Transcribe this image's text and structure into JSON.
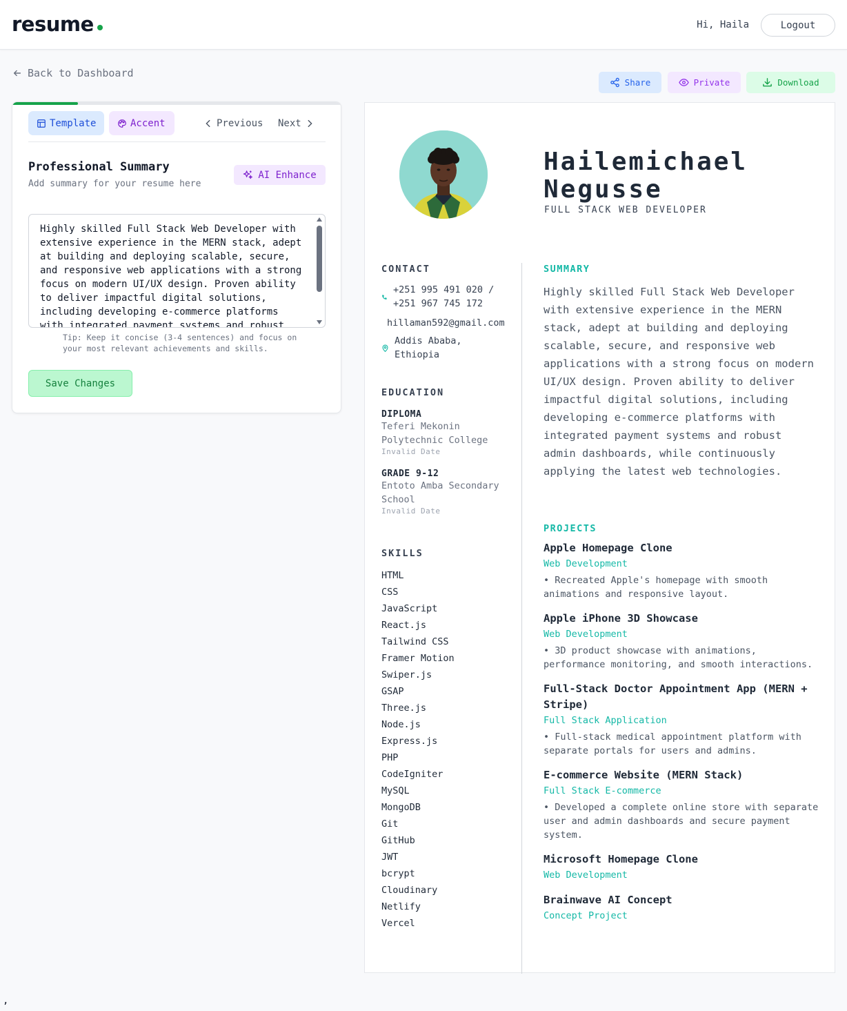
{
  "header": {
    "logo": "resume",
    "greeting": "Hi, Haila",
    "logout_label": "Logout"
  },
  "nav": {
    "back_label": "Back to Dashboard"
  },
  "editor": {
    "progress_fraction": 0.2,
    "template_label": "Template",
    "accent_label": "Accent",
    "previous_label": "Previous",
    "next_label": "Next",
    "section_title": "Professional Summary",
    "section_subtitle": "Add summary for your resume here",
    "ai_label": "AI Enhance",
    "summary_value": "Highly skilled Full Stack Web Developer with\nextensive experience in the MERN stack, adept\nat building and deploying scalable, secure,\nand responsive web applications with a strong\nfocus on modern UI/UX design. Proven ability\nto deliver impactful digital solutions,\nincluding developing e-commerce platforms\nwith integrated payment systems and robust",
    "tip": "Tip: Keep it concise (3-4 sentences) and focus on your most relevant achievements and skills.",
    "save_label": "Save Changes"
  },
  "actions": {
    "share_label": "Share",
    "private_label": "Private",
    "download_label": "Download"
  },
  "resume": {
    "first_name": "Hailemichael",
    "last_name": "Negusse",
    "role": "FULL STACK WEB DEVELOPER",
    "contact_heading": "CONTACT",
    "phone": "+251 995 491 020 /\n+251 967 745 172",
    "email": "hillaman592@gmail.com",
    "location": "Addis Ababa,\nEthiopia",
    "education_heading": "EDUCATION",
    "education": [
      {
        "degree": "DIPLOMA",
        "school": "Teferi Mekonin\nPolytechnic College",
        "date": "Invalid Date"
      },
      {
        "degree": "GRADE 9-12",
        "school": "Entoto Amba Secondary\nSchool",
        "date": "Invalid Date"
      }
    ],
    "skills_heading": "SKILLS",
    "skills": [
      "HTML",
      "CSS",
      "JavaScript",
      "React.js",
      "Tailwind CSS",
      "Framer Motion",
      "Swiper.js",
      "GSAP",
      "Three.js",
      "Node.js",
      "Express.js",
      "PHP",
      "CodeIgniter",
      "MySQL",
      "MongoDB",
      "Git",
      "GitHub",
      "JWT",
      "bcrypt",
      "Cloudinary",
      "Netlify",
      "Vercel"
    ],
    "summary_heading": "SUMMARY",
    "summary": "Highly skilled Full Stack Web Developer with extensive experience in the MERN stack, adept at building and deploying scalable, secure, and responsive web applications with a strong focus on modern UI/UX design. Proven ability to deliver impactful digital solutions, including developing e-commerce platforms with integrated payment systems and robust admin dashboards, while continuously applying the latest web technologies.",
    "projects_heading": "PROJECTS",
    "projects": [
      {
        "title": "Apple Homepage Clone",
        "type": "Web Development",
        "desc": "• Recreated Apple's homepage with smooth animations and responsive layout."
      },
      {
        "title": "Apple iPhone 3D Showcase",
        "type": "Web Development",
        "desc": "• 3D product showcase with animations, performance monitoring, and smooth interactions."
      },
      {
        "title": "Full-Stack Doctor Appointment App (MERN + Stripe)",
        "type": "Full Stack Application",
        "desc": "• Full-stack medical appointment platform with separate portals for users and admins."
      },
      {
        "title": "E-commerce Website (MERN Stack)",
        "type": "Full Stack E-commerce",
        "desc": "• Developed a complete online store with separate user and admin dashboards and secure payment system."
      },
      {
        "title": "Microsoft Homepage Clone",
        "type": "Web Development",
        "desc": ""
      },
      {
        "title": "Brainwave AI Concept",
        "type": "Concept Project",
        "desc": ""
      }
    ]
  },
  "footer_char": ","
}
